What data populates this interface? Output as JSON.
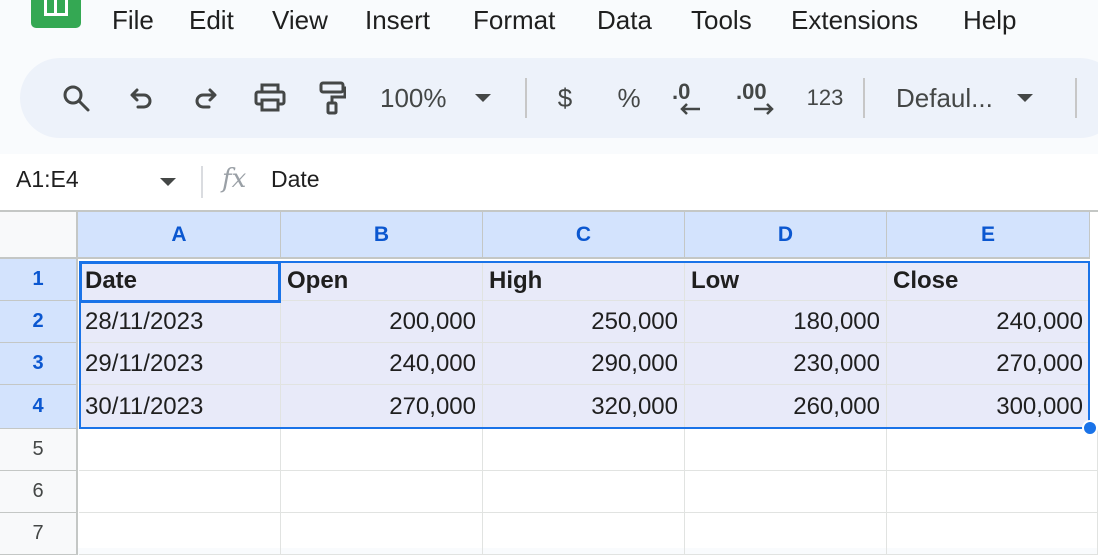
{
  "menu": {
    "items": [
      "File",
      "Edit",
      "View",
      "Insert",
      "Format",
      "Data",
      "Tools",
      "Extensions",
      "Help"
    ]
  },
  "toolbar": {
    "zoom": "100%",
    "currency": "$",
    "percent": "%",
    "decrease_decimal": ".0",
    "increase_decimal": ".00",
    "number_format": "123",
    "font": "Defaul..."
  },
  "formula_bar": {
    "name_box": "A1:E4",
    "fx": "fx",
    "value": "Date"
  },
  "sheet": {
    "columns": [
      "A",
      "B",
      "C",
      "D",
      "E"
    ],
    "row_numbers": [
      "1",
      "2",
      "3",
      "4",
      "5",
      "6",
      "7"
    ],
    "header": [
      "Date",
      "Open",
      "High",
      "Low",
      "Close"
    ],
    "rows": [
      [
        "28/11/2023",
        "200,000",
        "250,000",
        "180,000",
        "240,000"
      ],
      [
        "29/11/2023",
        "240,000",
        "290,000",
        "230,000",
        "270,000"
      ],
      [
        "30/11/2023",
        "270,000",
        "320,000",
        "260,000",
        "300,000"
      ]
    ]
  },
  "colors": {
    "selection_fill": "#e8eaf9",
    "selection_border": "#1a73e8",
    "header_selected": "#d3e3fd",
    "toolbar_bg": "#edf2fa",
    "app_green": "#34a853"
  },
  "icons": [
    "sheets-logo-icon",
    "search-icon",
    "undo-icon",
    "redo-icon",
    "print-icon",
    "paint-format-icon",
    "dropdown-caret-icon",
    "fx-icon"
  ]
}
